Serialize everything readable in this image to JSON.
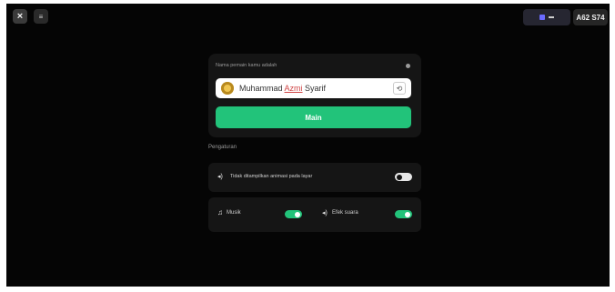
{
  "topbar": {
    "close_icon": "×",
    "menu_icon": "≡",
    "user_badge": "A62 S74"
  },
  "name_card": {
    "label": "Nama pemain kamu adalah",
    "name_prefix": "Muhammad ",
    "name_highlight": "Azmi",
    "name_suffix": " Syarif",
    "refresh_icon": "⟲",
    "play_label": "Main"
  },
  "settings": {
    "section_title": "Pengaturan",
    "reduced_motion_label": "Tidak ditampilkan animasi pada layar",
    "reduced_motion_on": false,
    "music_icon": "♫",
    "music_label": "Musik",
    "music_on": true,
    "sfx_icon": "◂)",
    "sfx_label": "Efek suara",
    "sfx_on": true,
    "speaker_icon": "◂)"
  },
  "colors": {
    "accent": "#22c37a",
    "background": "#050505",
    "card": "#151515"
  }
}
